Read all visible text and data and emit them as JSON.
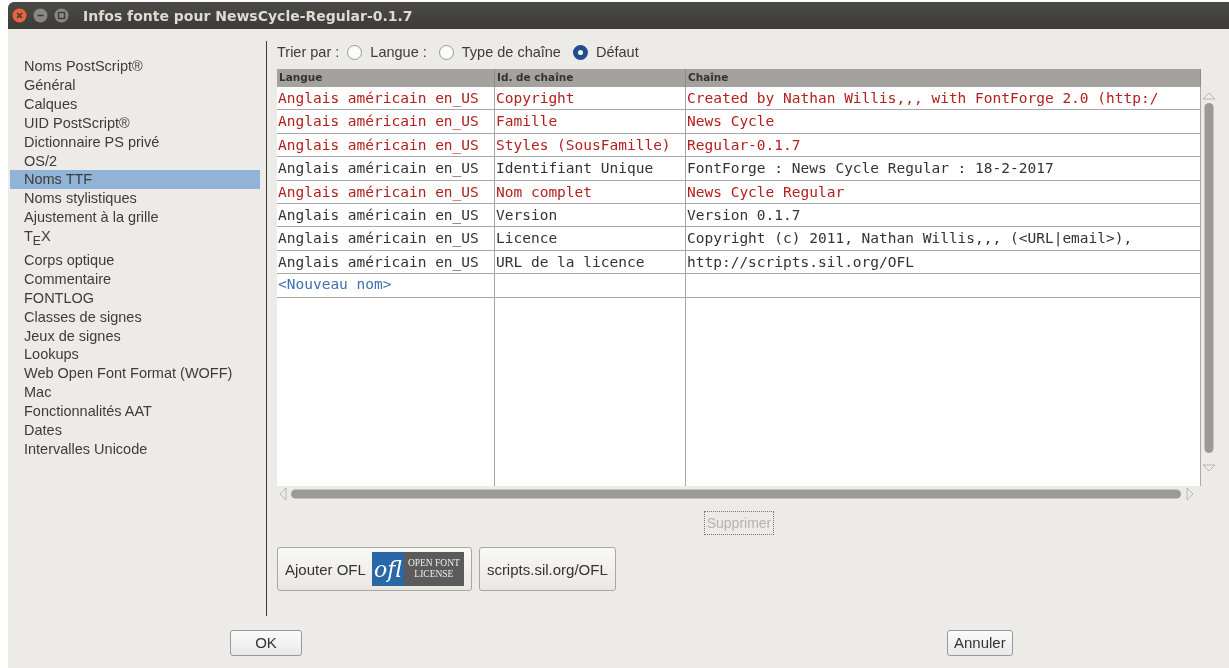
{
  "window": {
    "title": "Infos fonte pour NewsCycle-Regular-0.1.7"
  },
  "sidebar": {
    "items": [
      {
        "label": "Noms PostScript®",
        "selected": false
      },
      {
        "label": "Général",
        "selected": false
      },
      {
        "label": "Calques",
        "selected": false
      },
      {
        "label": "UID PostScript®",
        "selected": false
      },
      {
        "label": "Dictionnaire PS privé",
        "selected": false
      },
      {
        "label": "OS/2",
        "selected": false
      },
      {
        "label": "Noms TTF",
        "selected": true
      },
      {
        "label": "Noms stylistiques",
        "selected": false
      },
      {
        "label": "Ajustement à la grille",
        "selected": false
      },
      {
        "label": "T$_{E}$X",
        "selected": false
      },
      {
        "label": "Corps optique",
        "selected": false
      },
      {
        "label": "Commentaire",
        "selected": false
      },
      {
        "label": "FONTLOG",
        "selected": false
      },
      {
        "label": "Classes de signes",
        "selected": false
      },
      {
        "label": "Jeux de signes",
        "selected": false
      },
      {
        "label": "Lookups",
        "selected": false
      },
      {
        "label": "Web Open Font Format (WOFF)",
        "selected": false
      },
      {
        "label": "Mac",
        "selected": false
      },
      {
        "label": "Fonctionnalités AAT",
        "selected": false
      },
      {
        "label": "Dates",
        "selected": false
      },
      {
        "label": "Intervalles Unicode",
        "selected": false
      }
    ]
  },
  "sort": {
    "label": "Trier par :",
    "options": [
      {
        "label": "Langue :",
        "selected": false
      },
      {
        "label": "Type de chaîne",
        "selected": false
      },
      {
        "label": "Défaut",
        "selected": true
      }
    ]
  },
  "table": {
    "columns": [
      "Langue",
      "Id. de chaîne",
      "Chaîne"
    ],
    "rows": [
      {
        "cells": [
          "Anglais américain en_US",
          "Copyright",
          "Created by Nathan Willis,,, with FontForge 2.0 (http:/"
        ],
        "changed": true
      },
      {
        "cells": [
          "Anglais américain en_US",
          "Famille",
          "News Cycle"
        ],
        "changed": true
      },
      {
        "cells": [
          "Anglais américain en_US",
          "Styles (SousFamille)",
          "Regular-0.1.7"
        ],
        "changed": true
      },
      {
        "cells": [
          "Anglais américain en_US",
          "Identifiant Unique",
          "FontForge : News Cycle Regular : 18-2-2017"
        ],
        "changed": false
      },
      {
        "cells": [
          "Anglais américain en_US",
          "Nom complet",
          "News Cycle Regular"
        ],
        "changed": true
      },
      {
        "cells": [
          "Anglais américain en_US",
          "Version",
          "Version 0.1.7"
        ],
        "changed": false
      },
      {
        "cells": [
          "Anglais américain en_US",
          "Licence",
          "Copyright (c) 2011, Nathan Willis,,, (<URL|email>),"
        ],
        "changed": false
      },
      {
        "cells": [
          "Anglais américain en_US",
          "URL de la licence",
          "http://scripts.sil.org/OFL"
        ],
        "changed": false
      }
    ],
    "new_row_label": "<Nouveau nom>"
  },
  "delete_button": {
    "label": "Supprimer",
    "disabled": true
  },
  "add_ofl_button": {
    "label": "Ajouter OFL",
    "logo_mark": "ofl",
    "logo_lines": [
      "OPEN FONT",
      "LICENSE"
    ]
  },
  "link_button": {
    "label": "scripts.sil.org/OFL"
  },
  "buttons": [
    {
      "label": "OK"
    },
    {
      "label": "Annuler"
    }
  ]
}
